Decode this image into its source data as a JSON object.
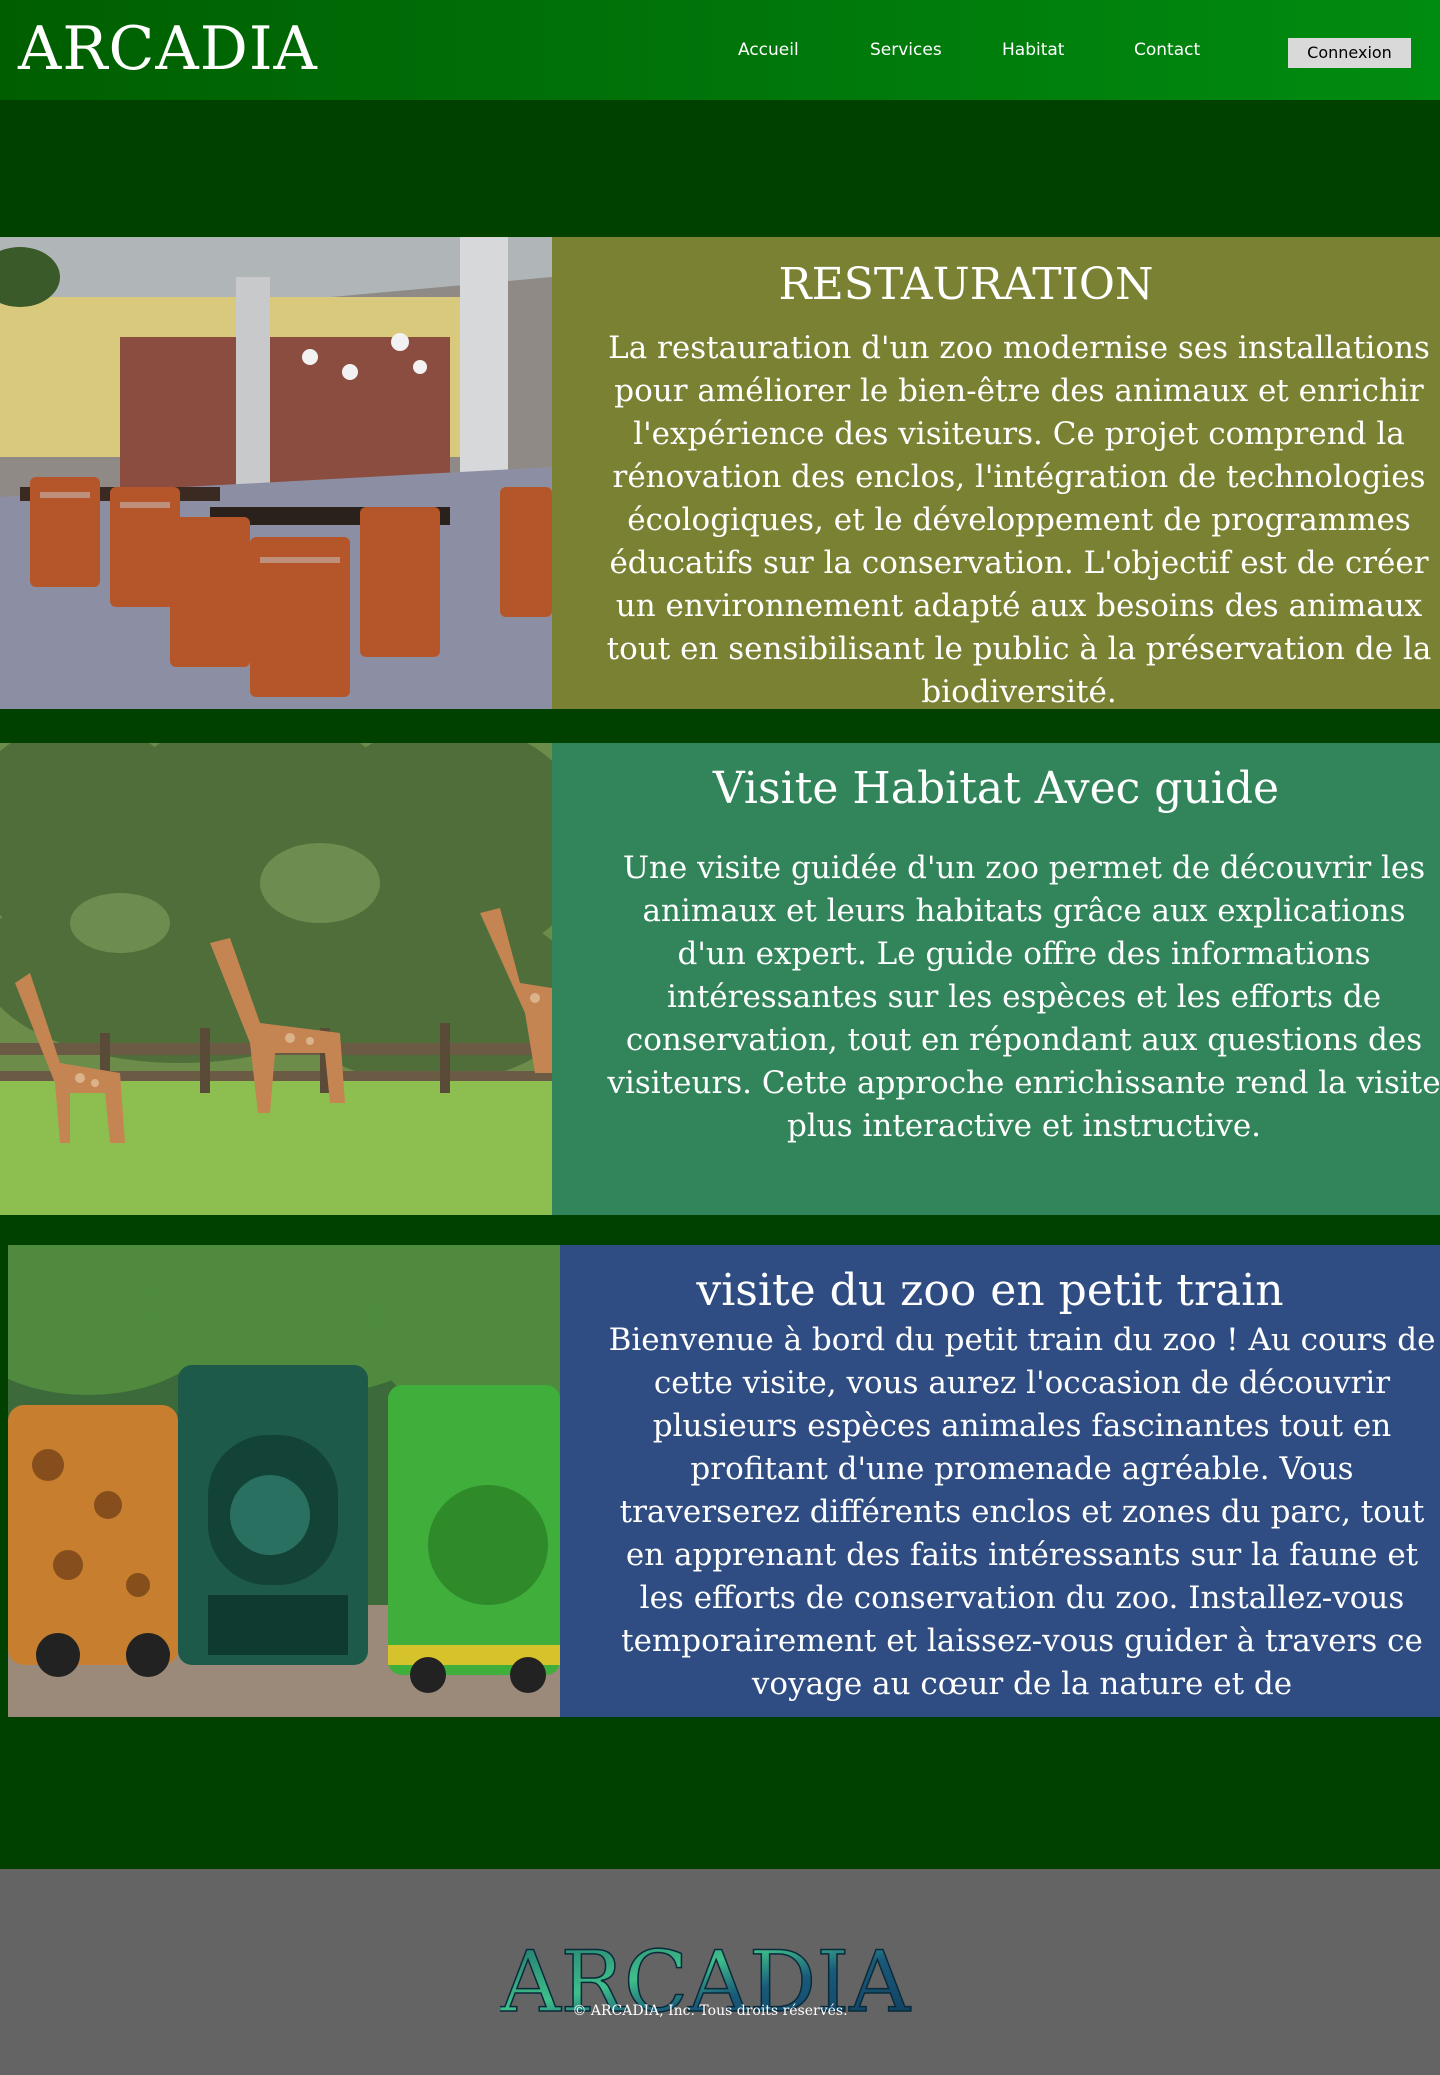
{
  "header": {
    "logo": "ARCADIA",
    "nav": [
      "Accueil",
      "Services",
      "Habitat",
      "Contact"
    ],
    "login_label": "Connexion"
  },
  "sections": [
    {
      "title": "RESTAURATION",
      "body": "La restauration d'un zoo modernise ses installations pour améliorer le bien-être des animaux et enrichir l'expérience des visiteurs. Ce projet comprend la rénovation des enclos, l'intégration de technologies écologiques, et le développement de programmes éducatifs sur la conservation. L'objectif est de créer un environnement adapté aux besoins des animaux tout en sensibilisant le public à la préservation de la biodiversité.",
      "bg": "#7a8133"
    },
    {
      "title": "Visite Habitat Avec guide",
      "body": "Une visite guidée d'un zoo permet de découvrir les animaux et leurs habitats grâce aux explications d'un expert. Le guide offre des informations intéressantes sur les espèces et les efforts de conservation, tout en répondant aux questions des visiteurs. Cette approche enrichissante rend la visite plus interactive et instructive.",
      "bg": "#32855a"
    },
    {
      "title": "visite du zoo en petit train",
      "body": "Bienvenue à bord du petit train du zoo ! Au cours de cette visite, vous aurez l'occasion de découvrir plusieurs espèces animales fascinantes tout en profitant d'une promenade agréable. Vous traverserez différents enclos et zones du parc, tout en apprenant des faits intéressants sur la faune et les efforts de conservation du zoo. Installez-vous temporairement et laissez-vous guider à travers ce voyage au cœur de la nature et de",
      "bg": "#2f4d83"
    }
  ],
  "footer": {
    "logo": "ARCADIA",
    "copyright": "© ARCADIA, Inc. Tous droits réservés."
  },
  "colors": {
    "page_bg": "#004100",
    "header_start": "#005e00",
    "header_end": "#008c10",
    "footer_bg": "#646464"
  }
}
